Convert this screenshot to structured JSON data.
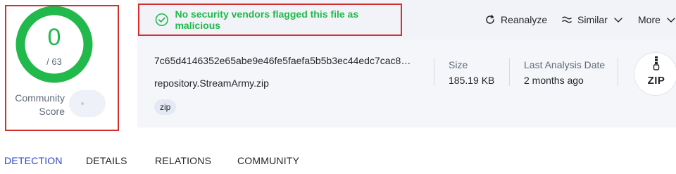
{
  "score": {
    "detections": "0",
    "total": "/ 63",
    "community_label": "Community Score"
  },
  "status": {
    "message": "No security vendors flagged this file as malicious",
    "color": "#21b94b"
  },
  "actions": {
    "reanalyze": "Reanalyze",
    "similar": "Similar",
    "more": "More"
  },
  "file": {
    "hash": "7c65d4146352e65abe9e46fe5faefa5b5b3ec44edc7cac8ba…",
    "name": "repository.StreamArmy.zip",
    "tag": "zip",
    "size_label": "Size",
    "size_value": "185.19 KB",
    "last_analysis_label": "Last Analysis Date",
    "last_analysis_value": "2 months ago",
    "type_badge": "ZIP"
  },
  "tabs": [
    {
      "label": "DETECTION",
      "active": true
    },
    {
      "label": "DETAILS",
      "active": false
    },
    {
      "label": "RELATIONS",
      "active": false
    },
    {
      "label": "COMMUNITY",
      "active": false
    }
  ],
  "colors": {
    "accent_tab": "#2d48c9",
    "clean": "#21b94b",
    "highlight_box": "#d32f2f"
  },
  "icons": [
    "check-circle-icon",
    "reanalyze-icon",
    "similar-icon",
    "chevron-down-icon",
    "zip-file-icon"
  ]
}
